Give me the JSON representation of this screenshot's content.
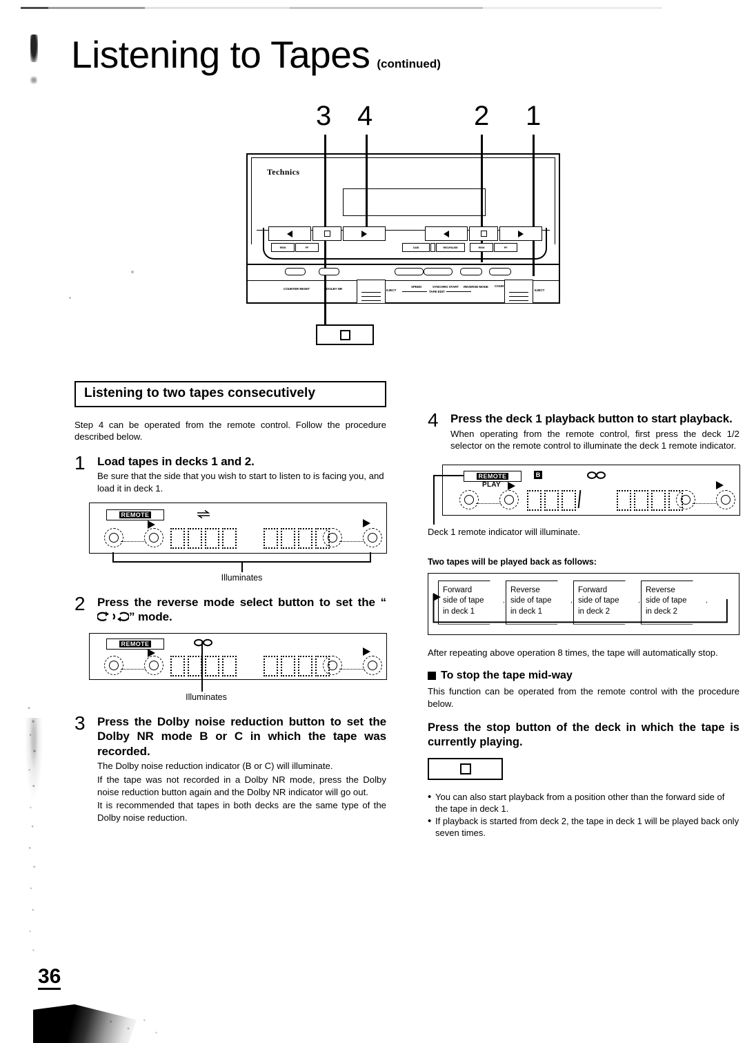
{
  "page": {
    "title": "Listening to Tapes",
    "title_suffix": "(continued)",
    "number": "36"
  },
  "diagram": {
    "brand": "Technics",
    "callouts": [
      "3",
      "4",
      "2",
      "1"
    ],
    "deck_labels": {
      "counter_reset_1": "COUNTER RESET",
      "dolby_nr": "DOLBY NR",
      "eject_1": "EJECT",
      "speed": "SPEED",
      "synchro_start": "SYNCHRO START",
      "tape_edit": "TAPE EDIT",
      "reverse_mode": "REVERSE MODE",
      "counter_reset_2": "COUNTER RESET",
      "eject_2": "EJECT"
    },
    "transport_icons": [
      "reverse-play-triangle",
      "stop-square",
      "forward-play-triangle"
    ],
    "mini_buttons": [
      "REW",
      "FF",
      "DUB",
      "REC/PAUSE"
    ],
    "stop_callout_icon": "stop-square"
  },
  "left_column": {
    "section_heading": "Listening to two tapes consecutively",
    "intro": "Step 4 can be operated from the remote control. Follow the procedure described below.",
    "steps": [
      {
        "num": "1",
        "title": "Load tapes in decks 1 and 2.",
        "text": "Be sure that the side that you wish to start to listen to is facing you, and load it in deck 1.",
        "display_caption": "Illuminates"
      },
      {
        "num": "2",
        "title_before": "Press the reverse mode select button to set the “",
        "title_after": "” mode.",
        "symbol_name": "double-loop-reverse-mode-icon",
        "display_caption": "Illuminates"
      },
      {
        "num": "3",
        "title": "Press the Dolby noise reduction button to set the Dolby NR mode B or C in which the tape was recorded.",
        "text_1": "The Dolby noise reduction indicator (B or C) will illuminate.",
        "text_2": "If the tape was not recorded in a Dolby NR mode, press the Dolby noise reduction button again and the Dolby NR indicator will go out.",
        "text_3": "It is recommended that tapes in both decks are the same type of the Dolby noise reduction."
      }
    ],
    "display_1": {
      "badge": "REMOTE",
      "indicator": "reverse-arrows-icon"
    },
    "display_2": {
      "badge": "REMOTE",
      "indicator": "double-loop-reverse-mode-icon"
    }
  },
  "right_column": {
    "step4": {
      "num": "4",
      "title": "Press the deck 1 playback button to start playback.",
      "text": "When operating from the remote control, first press the deck 1/2 selector on the remote control to illuminate the deck 1 remote indicator."
    },
    "display_4": {
      "badge": "REMOTE",
      "play_label": "PLAY",
      "dolby_indicator": "B",
      "mode_indicator": "double-loop-reverse-mode-icon",
      "caption": "Deck 1 remote indicator will illuminate."
    },
    "flow": {
      "title": "Two tapes will be played back as follows:",
      "steps": [
        {
          "l1": "Forward",
          "l2": "side of tape",
          "l3": "in deck 1"
        },
        {
          "l1": "Reverse",
          "l2": "side of tape",
          "l3": "in deck 1"
        },
        {
          "l1": "Forward",
          "l2": "side of tape",
          "l3": "in deck 2"
        },
        {
          "l1": "Reverse",
          "l2": "side of tape",
          "l3": "in deck 2"
        }
      ]
    },
    "after_flow": "After repeating above operation 8 times, the tape will automatically stop.",
    "sub_heading": "To stop the tape mid-way",
    "sub_text": "This function can be operated from the remote control with the procedure below.",
    "bold_instruction": "Press the stop button of the deck in which the tape is currently playing.",
    "stop_button_icon": "stop-square",
    "bullets": [
      "You can also start playback from a position other than the forward side of the tape in deck 1.",
      "If playback is started from deck 2, the tape in deck 1 will be played back only seven times."
    ]
  }
}
